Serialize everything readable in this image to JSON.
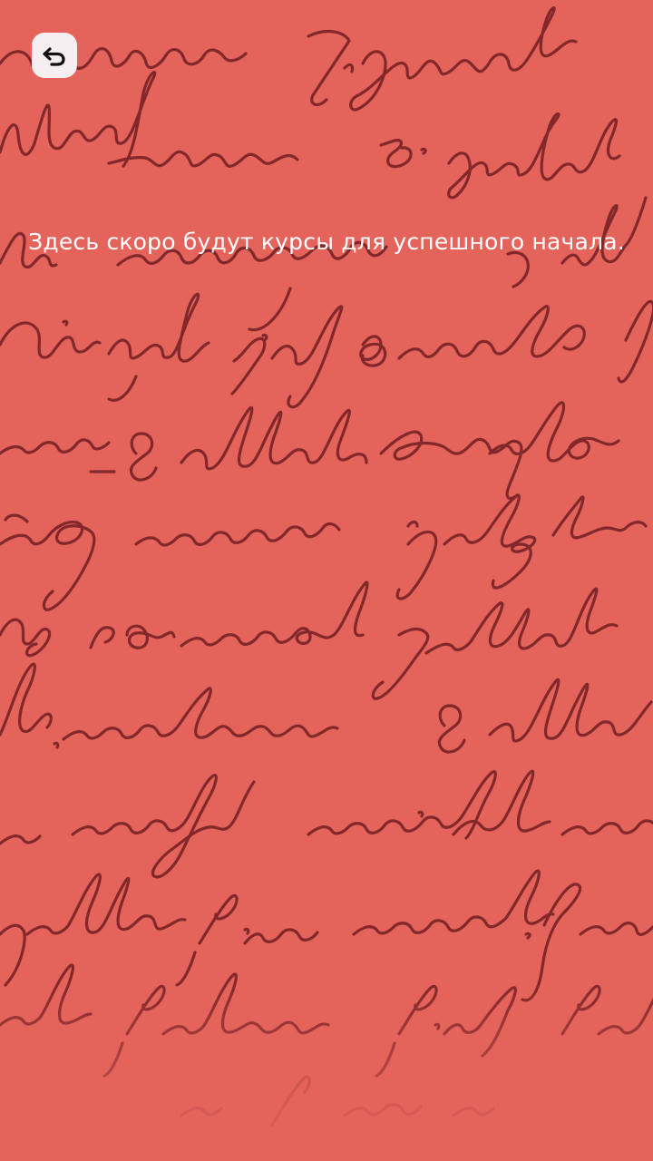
{
  "main": {
    "message": "Здесь скоро будут курсы для успешного начала."
  },
  "back_button": {
    "icon": "undo-arrow-icon"
  },
  "colors": {
    "background": "#e4635a",
    "handwriting": "#7a2226",
    "button_bg": "#f6eef0",
    "text": "#ffffff"
  }
}
